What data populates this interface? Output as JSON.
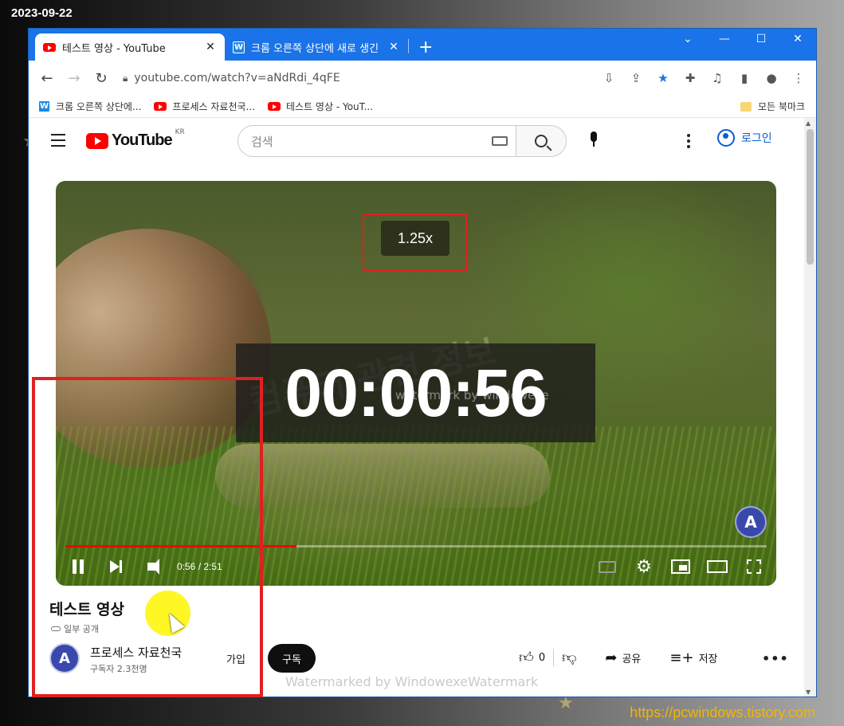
{
  "screenshot_date": "2023-09-22",
  "site_url": "https://pcwindows.tistory.com",
  "browser": {
    "tabs": [
      {
        "title": "테스트 영상 - YouTube",
        "active": true,
        "favicon": "youtube-favicon"
      },
      {
        "title": "크롬 오른쪽 상단에 새로 생긴 도",
        "active": false,
        "favicon": "w-favicon"
      }
    ],
    "new_tab_symbol": "+",
    "close_symbol": "✕",
    "window_controls": {
      "dropdown": "⌄",
      "minimize": "—",
      "maximize": "☐",
      "close": "✕"
    },
    "address": "youtube.com/watch?v=aNdRdi_4qFE",
    "bookmarks": [
      {
        "label": "크롬 오른쪽 상단에...",
        "favicon": "w-favicon"
      },
      {
        "label": "프로세스 자료천국...",
        "favicon": "youtube-favicon"
      },
      {
        "label": "테스트 영상 - YouT...",
        "favicon": "youtube-favicon"
      }
    ],
    "all_bookmarks": "모든 북마크"
  },
  "youtube": {
    "logo_text": "YouTube",
    "region": "KR",
    "search_placeholder": "검색",
    "login_label": "로그인",
    "player": {
      "speed_badge": "1.25x",
      "timer_overlay": "00:00:56",
      "watermark_text": "watermark by windowexe",
      "watermark_korean": "컴퓨터 관련 정보",
      "channel_watermark_letter": "A",
      "time_display": "0:56 / 2:51",
      "progress_fraction": 0.329,
      "progress_color": "#ff0000"
    },
    "video_title": "테스트 영상",
    "visibility": "일부 공개",
    "channel": {
      "avatar_letter": "A",
      "name": "프로세스 자료천국",
      "subscribers": "구독자 2.3천명"
    },
    "join_label": "가입",
    "subscribe_label": "구독",
    "like_count": "0",
    "share_label": "공유",
    "save_label": "저장",
    "more_label": "•••",
    "bottom_watermark": "Watermarked by WindowexeWatermark"
  },
  "colors": {
    "accent": "#1a73e8",
    "annotation": "#e02020",
    "yt_red": "#ff0000"
  }
}
